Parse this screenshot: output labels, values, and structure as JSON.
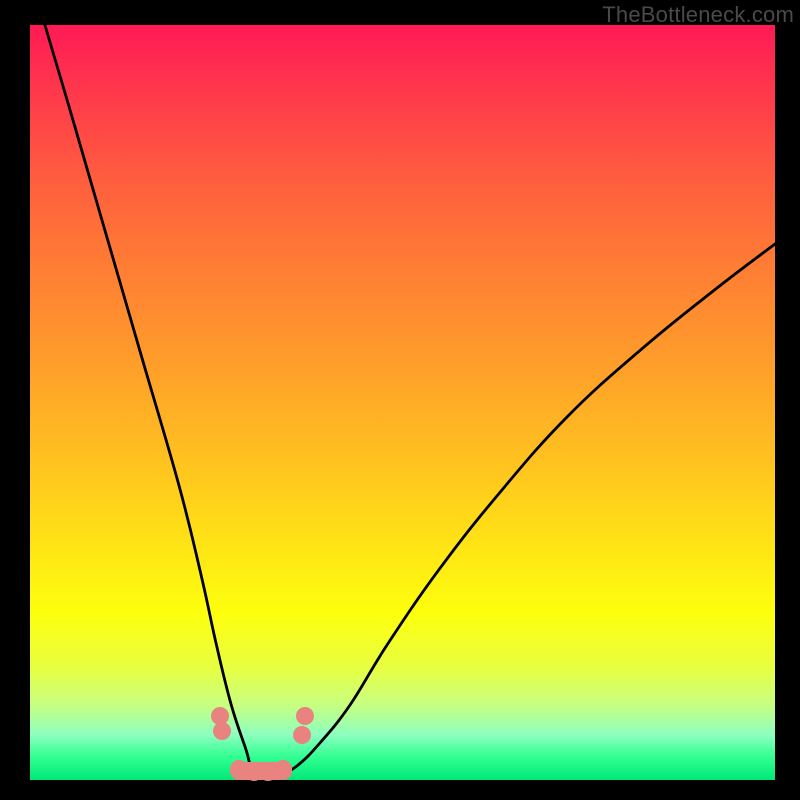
{
  "watermark": "TheBottleneck.com",
  "chart_data": {
    "type": "line",
    "title": "",
    "xlabel": "",
    "ylabel": "",
    "xlim": [
      0,
      100
    ],
    "ylim": [
      0,
      100
    ],
    "background_gradient": {
      "stops": [
        {
          "pct": 0,
          "meaning": "high-bottleneck",
          "color": "#ff1a55"
        },
        {
          "pct": 50,
          "meaning": "mid",
          "color": "#ffc020"
        },
        {
          "pct": 78,
          "meaning": "low",
          "color": "#fdff0d"
        },
        {
          "pct": 100,
          "meaning": "optimal",
          "color": "#00e878"
        }
      ]
    },
    "series": [
      {
        "name": "bottleneck-curve",
        "x": [
          2,
          5,
          10,
          15,
          20,
          23,
          25,
          27,
          29,
          30,
          32,
          34,
          36,
          39,
          43,
          48,
          55,
          63,
          72,
          82,
          92,
          100
        ],
        "values": [
          100,
          90,
          73,
          56,
          39,
          27,
          18,
          10,
          4,
          1,
          1,
          1,
          2,
          5,
          10,
          18,
          28,
          38,
          48,
          57,
          65,
          71
        ]
      }
    ],
    "highlight_points": {
      "name": "optimal-region-markers",
      "x": [
        25.5,
        25.8,
        28.0,
        30.0,
        32.0,
        34.0,
        36.5,
        36.9
      ],
      "values": [
        8.5,
        6.5,
        1.5,
        1.0,
        1.0,
        1.5,
        6.0,
        8.5
      ]
    }
  }
}
